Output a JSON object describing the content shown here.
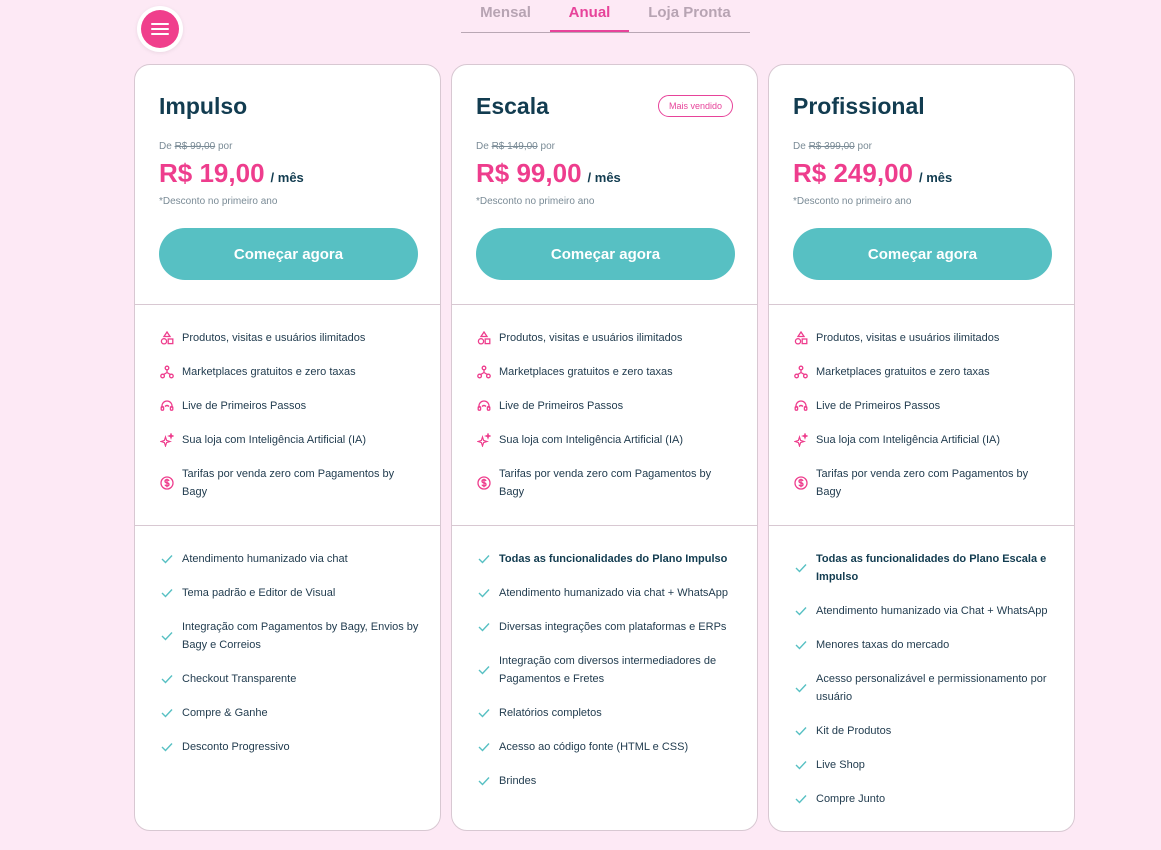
{
  "nav": {
    "tabs": [
      {
        "label": "Mensal",
        "active": false
      },
      {
        "label": "Anual",
        "active": true
      },
      {
        "label": "Loja Pronta",
        "active": false
      }
    ],
    "menu_icon": "hamburger-icon"
  },
  "colors": {
    "accent": "#ee3d8d",
    "button": "#57c0c3",
    "background": "#fde9f5",
    "text": "#123c50"
  },
  "plans": [
    {
      "name": "Impulso",
      "badge": "",
      "old_price_prefix": "De",
      "old_price": "R$ 99,00",
      "old_price_suffix": "por",
      "price": "R$ 19,00",
      "period": "/ mês",
      "discount_note": "*Desconto no primeiro ano",
      "cta": "Começar agora",
      "highlights": [
        {
          "icon": "shapes-icon",
          "text": "Produtos, visitas e usuários ilimitados"
        },
        {
          "icon": "network-icon",
          "text": "Marketplaces gratuitos e zero taxas"
        },
        {
          "icon": "support-icon",
          "text": "Live de Primeiros Passos"
        },
        {
          "icon": "sparkles-icon",
          "text": "Sua loja com Inteligência Artificial (IA)"
        },
        {
          "icon": "dollar-icon",
          "text": "Tarifas por venda zero com Pagamentos by Bagy"
        }
      ],
      "features": [
        "Atendimento humanizado via chat",
        "Tema padrão e Editor de Visual",
        "Integração com Pagamentos by Bagy, Envios by Bagy e Correios",
        "Checkout Transparente",
        "Compre & Ganhe",
        "Desconto Progressivo"
      ]
    },
    {
      "name": "Escala",
      "badge": "Mais vendido",
      "old_price_prefix": "De",
      "old_price": "R$ 149,00",
      "old_price_suffix": "por",
      "price": "R$ 99,00",
      "period": "/ mês",
      "discount_note": "*Desconto no primeiro ano",
      "cta": "Começar agora",
      "highlights": [
        {
          "icon": "shapes-icon",
          "text": "Produtos, visitas e usuários ilimitados"
        },
        {
          "icon": "network-icon",
          "text": "Marketplaces gratuitos e zero taxas"
        },
        {
          "icon": "support-icon",
          "text": "Live de Primeiros Passos"
        },
        {
          "icon": "sparkles-icon",
          "text": "Sua loja com Inteligência Artificial (IA)"
        },
        {
          "icon": "dollar-icon",
          "text": "Tarifas por venda zero com Pagamentos by Bagy"
        }
      ],
      "features": [
        "Todas as funcionalidades do Plano Impulso",
        "Atendimento humanizado via chat + WhatsApp",
        "Diversas integrações com plataformas e ERPs",
        "Integração com diversos intermediadores de Pagamentos e Fretes",
        "Relatórios completos",
        "Acesso ao código fonte (HTML e CSS)",
        "Brindes"
      ]
    },
    {
      "name": "Profissional",
      "badge": "",
      "old_price_prefix": "De",
      "old_price": "R$ 399,00",
      "old_price_suffix": "por",
      "price": "R$ 249,00",
      "period": "/ mês",
      "discount_note": "*Desconto no primeiro ano",
      "cta": "Começar agora",
      "highlights": [
        {
          "icon": "shapes-icon",
          "text": "Produtos, visitas e usuários ilimitados"
        },
        {
          "icon": "network-icon",
          "text": "Marketplaces gratuitos e zero taxas"
        },
        {
          "icon": "support-icon",
          "text": "Live de Primeiros Passos"
        },
        {
          "icon": "sparkles-icon",
          "text": "Sua loja com Inteligência Artificial (IA)"
        },
        {
          "icon": "dollar-icon",
          "text": "Tarifas por venda zero com Pagamentos by Bagy"
        }
      ],
      "features": [
        "Todas as funcionalidades do Plano Escala e Impulso",
        "Atendimento humanizado via Chat + WhatsApp",
        "Menores taxas do mercado",
        "Acesso personalizável e permissionamento por usuário",
        "Kit de Produtos",
        "Live Shop",
        "Compre Junto"
      ]
    }
  ]
}
